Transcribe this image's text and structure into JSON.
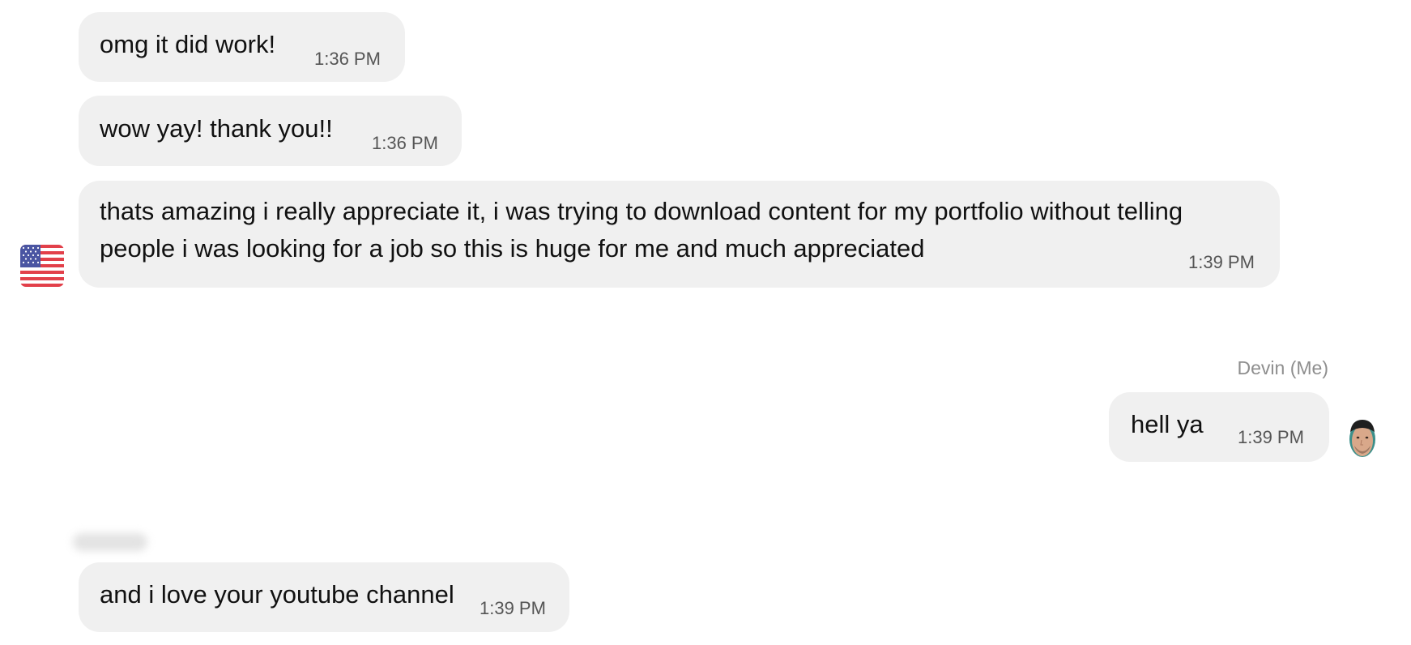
{
  "messages": [
    {
      "text": "omg it did work!",
      "time": "1:36 PM"
    },
    {
      "text": "wow yay! thank you!!",
      "time": "1:36 PM"
    },
    {
      "text": "thats amazing i really appreciate it, i was trying to download content for my portfolio without telling people i was looking for a job so this is huge for me and much appreciated",
      "time": "1:39 PM"
    },
    {
      "text": "hell ya",
      "time": "1:39 PM",
      "sender": "Devin (Me)"
    },
    {
      "text": "and i love your youtube channel",
      "time": "1:39 PM"
    }
  ],
  "icons": {
    "incoming_avatar": "us-flag-icon",
    "outgoing_avatar": "user-avatar"
  },
  "colors": {
    "bubble": "#f0f0f0",
    "sender_name": "#8e8e8e",
    "timestamp": "#555555"
  }
}
